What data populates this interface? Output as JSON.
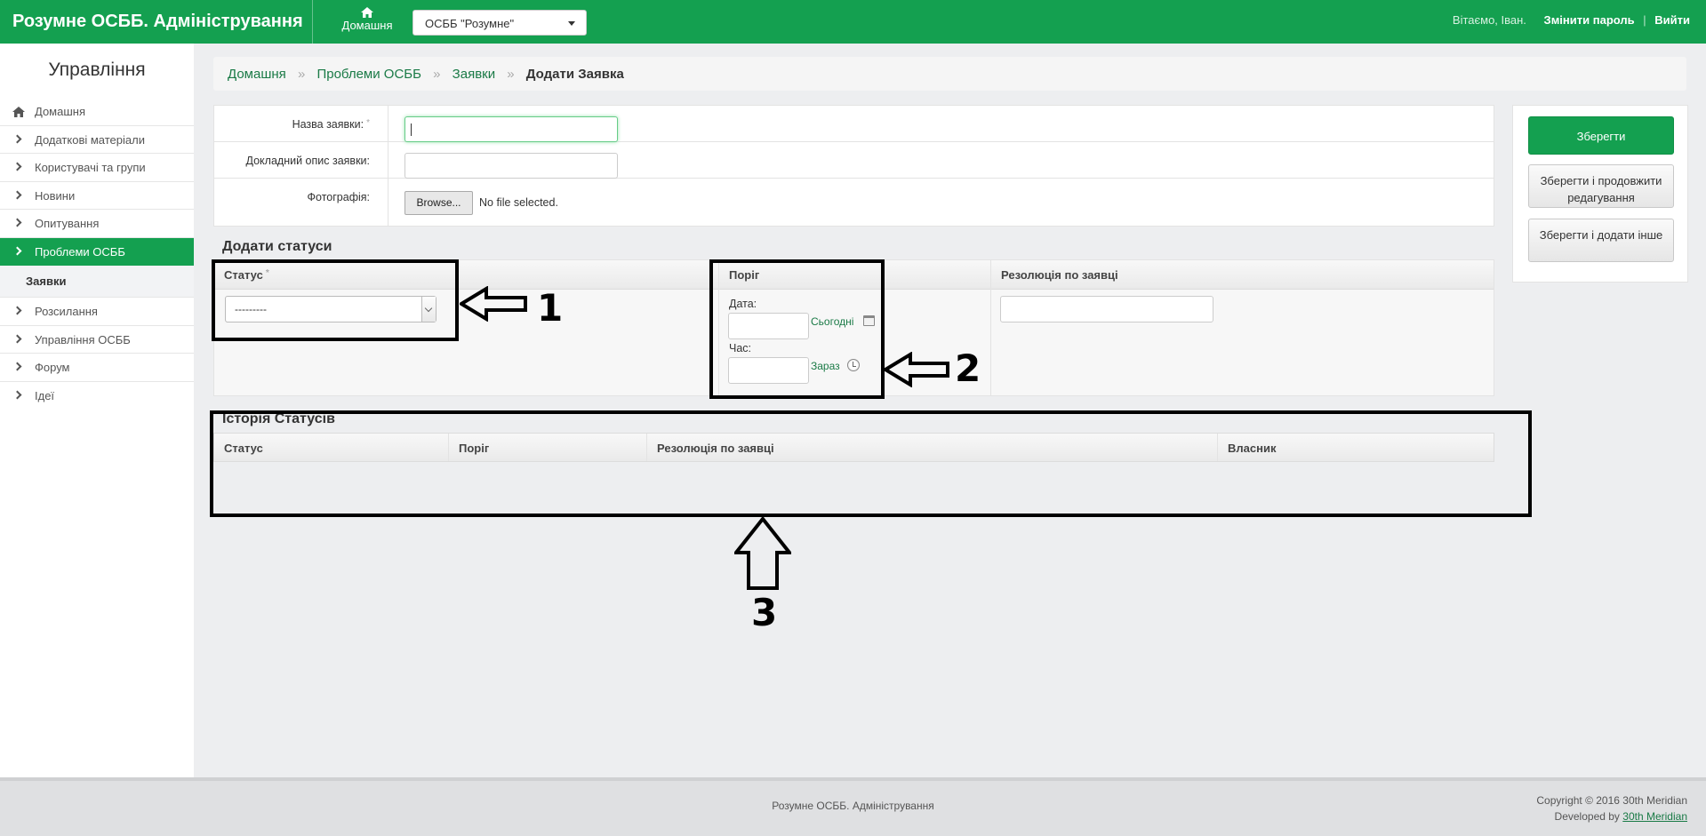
{
  "header": {
    "brand": "Розумне ОСББ. Адміністрування",
    "home_label": "Домашня",
    "osbb_selected": "ОСББ \"Розумне\"",
    "welcome": "Вітаємо, Іван.",
    "change_password": "Змінити пароль",
    "pipe": "|",
    "logout": "Вийти"
  },
  "sidebar": {
    "title": "Управління",
    "items": [
      {
        "label": "Домашня",
        "icon": "home-icon"
      },
      {
        "label": "Додаткові матеріали",
        "icon": "chevron-right-icon"
      },
      {
        "label": "Користувачі та групи",
        "icon": "chevron-right-icon"
      },
      {
        "label": "Новини",
        "icon": "chevron-right-icon"
      },
      {
        "label": "Опитування",
        "icon": "chevron-right-icon"
      },
      {
        "label": "Проблеми ОСББ",
        "icon": "chevron-right-icon",
        "active": true
      },
      {
        "label": "Розсилання",
        "icon": "chevron-right-icon"
      },
      {
        "label": "Управління ОСББ",
        "icon": "chevron-right-icon"
      },
      {
        "label": "Форум",
        "icon": "chevron-right-icon"
      },
      {
        "label": "Ідеї",
        "icon": "chevron-right-icon"
      }
    ],
    "submenu_active": "Заявки"
  },
  "breadcrumb": {
    "items": [
      "Домашня",
      "Проблеми ОСББ",
      "Заявки"
    ],
    "separator": "»",
    "current": "Додати Заявка"
  },
  "form": {
    "title_label": "Назва заявки:",
    "title_value": "",
    "required_mark": "*",
    "description_label": "Докладний опис заявки:",
    "description_value": "",
    "photo_label": "Фотографія:",
    "browse_button": "Browse...",
    "file_status": "No file selected."
  },
  "actions": {
    "save": "Зберегти",
    "save_continue": "Зберегти і продовжити редагування",
    "save_add": "Зберегти і додати інше"
  },
  "add_statuses": {
    "title": "Додати статуси",
    "col_status": "Статус",
    "col_threshold": "Поріг",
    "col_resolution": "Резолюція по заявці",
    "status_selected": "---------",
    "date_label": "Дата:",
    "today_link": "Сьогодні",
    "time_label": "Час:",
    "now_link": "Зараз"
  },
  "history": {
    "title": "Історія Статусів",
    "columns": [
      "Статус",
      "Поріг",
      "Резолюція по заявці",
      "Власник"
    ]
  },
  "annotations": [
    "1",
    "2",
    "3"
  ],
  "footer": {
    "center": "Розумне ОСББ. Адміністрування",
    "copyright": "Copyright © 2016 30th Meridian",
    "developed_by": "Developed by",
    "developer": "30th Meridian"
  },
  "colors": {
    "brand_green": "#14a050",
    "link_green": "#1a7a46"
  }
}
